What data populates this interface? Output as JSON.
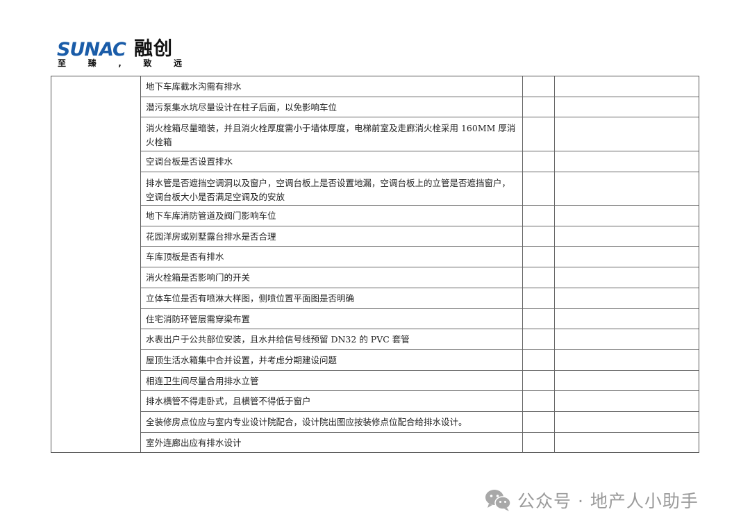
{
  "logo": {
    "brand_en": "SUNAC",
    "brand_cn": "融创",
    "slogan": [
      "至",
      "臻",
      ",",
      "致",
      "远"
    ]
  },
  "table": {
    "rows": [
      {
        "text": "地下车库截水沟需有排水"
      },
      {
        "text": "潜污泵集水坑尽量设计在柱子后面，以免影响车位"
      },
      {
        "text": "消火栓箱尽量暗装，并且消火栓厚度需小于墙体厚度，电梯前室及走廊消火栓采用 160MM 厚消火栓箱"
      },
      {
        "text": "空调台板是否设置排水"
      },
      {
        "text": "排水管是否遮挡空调洞以及窗户，空调台板上是否设置地漏，空调台板上的立管是否遮挡窗户，空调台板大小是否满足空调及的安放"
      },
      {
        "text": "地下车库消防管道及阀门影响车位"
      },
      {
        "text": "花园洋房或别墅露台排水是否合理"
      },
      {
        "text": "车库顶板是否有排水"
      },
      {
        "text": "消火栓箱是否影响门的开关"
      },
      {
        "text": "立体车位是否有喷淋大样图，侧喷位置平面图是否明确"
      },
      {
        "text": "住宅消防环管层需穿梁布置"
      },
      {
        "text": "水表出户于公共部位安装，且水井给信号线预留 DN32 的 PVC 套管"
      },
      {
        "text": "屋顶生活水箱集中合并设置，并考虑分期建设问题"
      },
      {
        "text": "相连卫生间尽量合用排水立管"
      },
      {
        "text": "排水横管不得走卧式，且横管不得低于窗户"
      },
      {
        "text": "全装修房点位应与室内专业设计院配合，设计院出图应按装修点位配合给排水设计。"
      },
      {
        "text": "室外连廊出应有排水设计"
      }
    ]
  },
  "watermark": {
    "icon": "wechat-icon",
    "text": "公众号 · 地产人小助手"
  }
}
